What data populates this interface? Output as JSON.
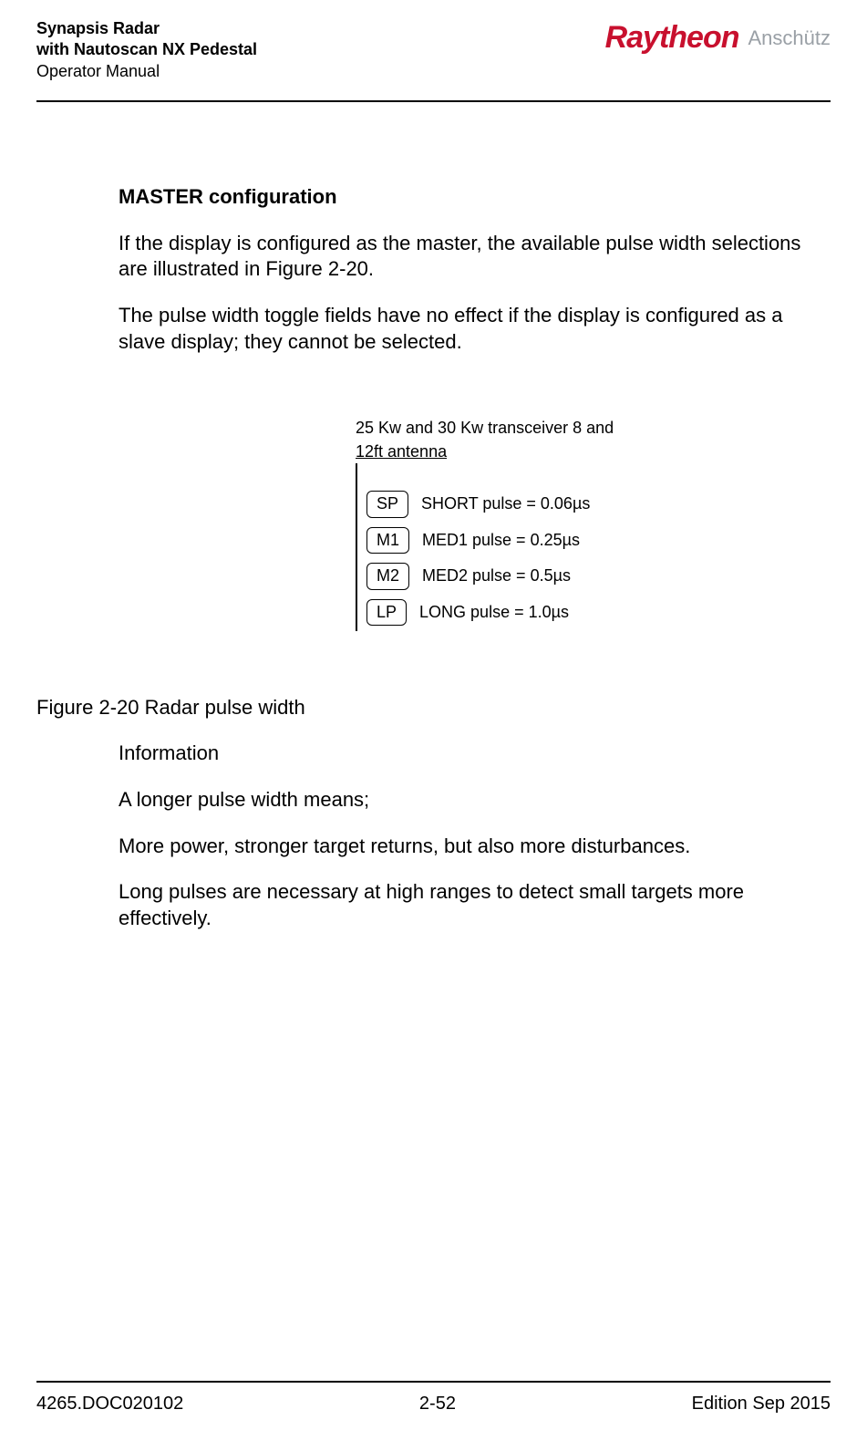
{
  "header": {
    "line1": "Synapsis Radar",
    "line2": "with Nautoscan NX Pedestal",
    "line3": "Operator Manual",
    "brand1": "Raytheon",
    "brand2": "Anschütz"
  },
  "section": {
    "title": "MASTER configuration",
    "p1": "If the display is configured as the master, the available pulse width selections are illustrated in Figure 2-20.",
    "p2": "The pulse width toggle fields have no effect if the display is configured as a slave display; they cannot be selected."
  },
  "diagram": {
    "title_l1": "25 Kw and 30 Kw transceiver 8 and",
    "title_l2": "12ft antenna",
    "rows": [
      {
        "code": "SP",
        "desc": "SHORT pulse = 0.06µs"
      },
      {
        "code": "M1",
        "desc": "MED1 pulse = 0.25µs"
      },
      {
        "code": "M2",
        "desc": "MED2 pulse = 0.5µs"
      },
      {
        "code": "LP",
        "desc": "LONG pulse = 1.0µs"
      }
    ]
  },
  "figure_caption": "Figure 2-20     Radar pulse width",
  "info": {
    "h": "Information",
    "p1": "A longer pulse width means;",
    "p2": "More power, stronger target returns, but also more disturbances.",
    "p3": "Long pulses are necessary at high ranges to detect small targets more effectively."
  },
  "footer": {
    "left": "4265.DOC020102",
    "center": "2-52",
    "right": "Edition Sep 2015"
  }
}
